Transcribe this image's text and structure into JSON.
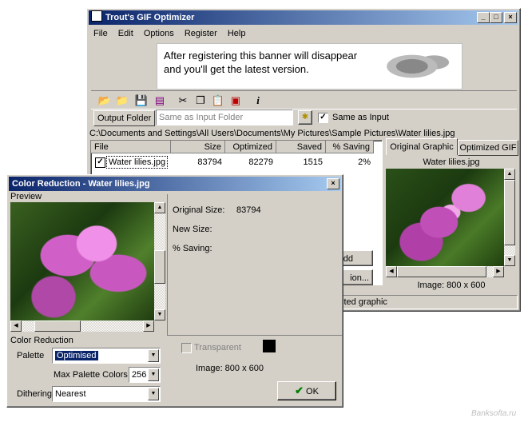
{
  "main_window": {
    "title": "Trout's GIF Optimizer",
    "menu": [
      "File",
      "Edit",
      "Options",
      "Register",
      "Help"
    ],
    "banner_text": "After registering this banner will disappear and you'll get the latest version.",
    "output_folder_label": "Output Folder",
    "output_folder_placeholder": "Same as Input Folder",
    "same_as_input_label": "Same as Input",
    "same_as_input_checked": true,
    "path": "C:\\Documents and Settings\\All Users\\Documents\\My Pictures\\Sample Pictures\\Water lilies.jpg",
    "table": {
      "columns": [
        "File",
        "Size",
        "Optimized",
        "Saved",
        "% Saving"
      ],
      "rows": [
        {
          "file": "Water lilies.jpg",
          "size": "83794",
          "optimized": "82279",
          "saved": "1515",
          "saving": "2%",
          "checked": true
        }
      ]
    },
    "tabs": [
      "Original Graphic",
      "Optimized GIF"
    ],
    "active_tab": "Original Graphic",
    "preview_file": "Water lilies.jpg",
    "image_info": "Image: 800 x 600",
    "add_button_partial": "Add",
    "action_button_partial": "ion...",
    "status_partial": "cted graphic"
  },
  "dialog": {
    "title": "Color Reduction - Water lilies.jpg",
    "preview_label": "Preview",
    "original_size_label": "Original Size:",
    "original_size_value": "83794",
    "new_size_label": "New Size:",
    "saving_label": "% Saving:",
    "color_reduction_label": "Color Reduction",
    "palette_label": "Palette",
    "palette_value": "Optimised",
    "max_palette_label": "Max Palette Colors",
    "max_palette_value": "256",
    "dithering_label": "Dithering",
    "dithering_value": "Nearest",
    "transparent_label": "Transparent",
    "transparent_color": "#000000",
    "image_info": "Image: 800 x 600",
    "ok_label": "OK"
  },
  "watermark": "Banksofta.ru",
  "icons": {
    "open": "folder-open-icon",
    "folder": "folder-icon",
    "save": "save-icon",
    "batch": "batch-icon",
    "cut": "cut-icon",
    "copy": "copy-icon",
    "paste": "paste-icon",
    "optimize": "optimize-icon",
    "info": "info-icon"
  }
}
